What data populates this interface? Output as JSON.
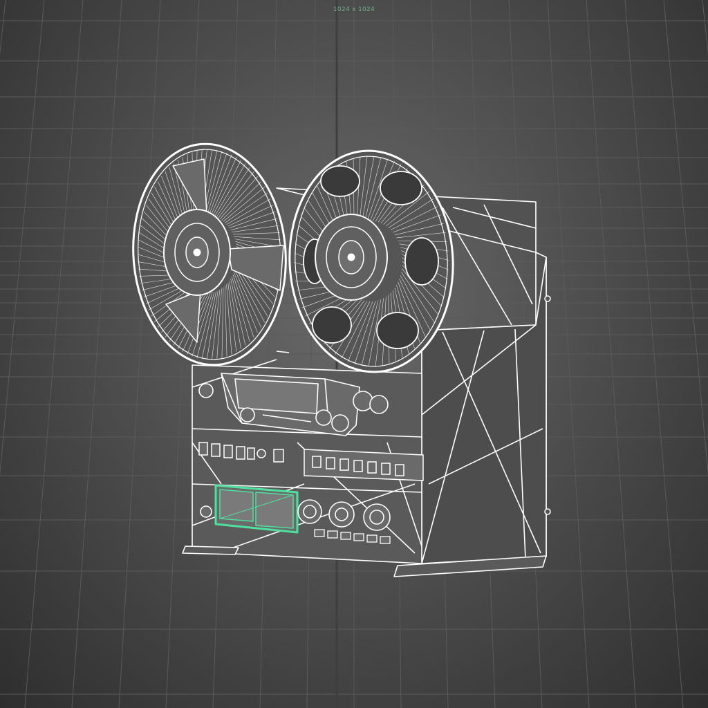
{
  "viewport": {
    "resolution_label": "1024 x 1024",
    "display_mode": "wireframe",
    "object": "reel-to-reel-tape-recorder",
    "selected_part": "meter-window"
  },
  "colors": {
    "background_center": "#6a6a6b",
    "background_edge": "#2e2e2f",
    "grid_line": "#5a5a5b",
    "grid_axis": "#3e3e3f",
    "wire": "#ffffff",
    "surface": "#525253",
    "selection": "#4fe0a0"
  }
}
